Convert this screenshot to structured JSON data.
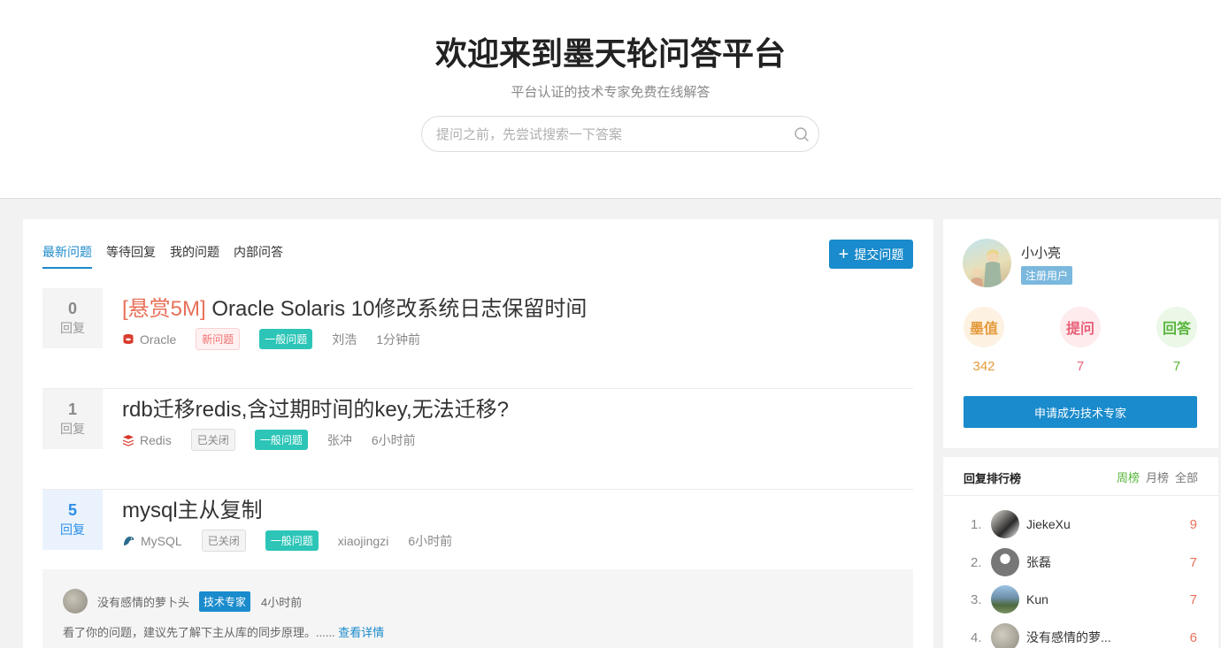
{
  "hero": {
    "title": "欢迎来到墨天轮问答平台",
    "subtitle": "平台认证的技术专家免费在线解答",
    "search_placeholder": "提问之前，先尝试搜索一下答案"
  },
  "tabs": [
    "最新问题",
    "等待回复",
    "我的问题",
    "内部问答"
  ],
  "ask_button": "提交问题",
  "reply_label": "回复",
  "questions": [
    {
      "count": "0",
      "reward": "[悬赏5M]",
      "title": " Oracle Solaris 10修改系统日志保留时间",
      "category": "Oracle",
      "status": "新问题",
      "type": "一般问题",
      "author": "刘浩",
      "time": "1分钟前"
    },
    {
      "count": "1",
      "reward": "",
      "title": "rdb迁移redis,含过期时间的key,无法迁移?",
      "category": "Redis",
      "status": "已关闭",
      "type": "一般问题",
      "author": "张冲",
      "time": "6小时前"
    },
    {
      "count": "5",
      "reward": "",
      "title": "mysql主从复制",
      "category": "MySQL",
      "status": "已关闭",
      "type": "一般问题",
      "author": "xiaojingzi",
      "time": "6小时前"
    }
  ],
  "answer": {
    "author": "没有感情的萝卜头",
    "badge": "技术专家",
    "time": "4小时前",
    "text": "看了你的问题，建议先了解下主从库的同步原理。......",
    "link": "查看详情"
  },
  "profile": {
    "name": "小小亮",
    "role": "注册用户",
    "stats": [
      {
        "label": "墨值",
        "value": "342"
      },
      {
        "label": "提问",
        "value": "7"
      },
      {
        "label": "回答",
        "value": "7"
      }
    ],
    "apply_button": "申请成为技术专家"
  },
  "ranking": {
    "title": "回复排行榜",
    "tabs": [
      "周榜",
      "月榜",
      "全部"
    ],
    "rows": [
      {
        "idx": "1.",
        "name": "JiekeXu",
        "count": "9"
      },
      {
        "idx": "2.",
        "name": "张磊",
        "count": "7"
      },
      {
        "idx": "3.",
        "name": "Kun",
        "count": "7"
      },
      {
        "idx": "4.",
        "name": "没有感情的萝...",
        "count": "6"
      }
    ]
  },
  "colors": {
    "accent": "#1a8bcc",
    "reward": "#e8705a",
    "tag_general": "#2cc5b7"
  },
  "icons": {
    "search": "search-icon",
    "plus": "plus-icon",
    "oracle": "oracle-db-icon",
    "redis": "redis-icon",
    "mysql": "mysql-icon"
  }
}
